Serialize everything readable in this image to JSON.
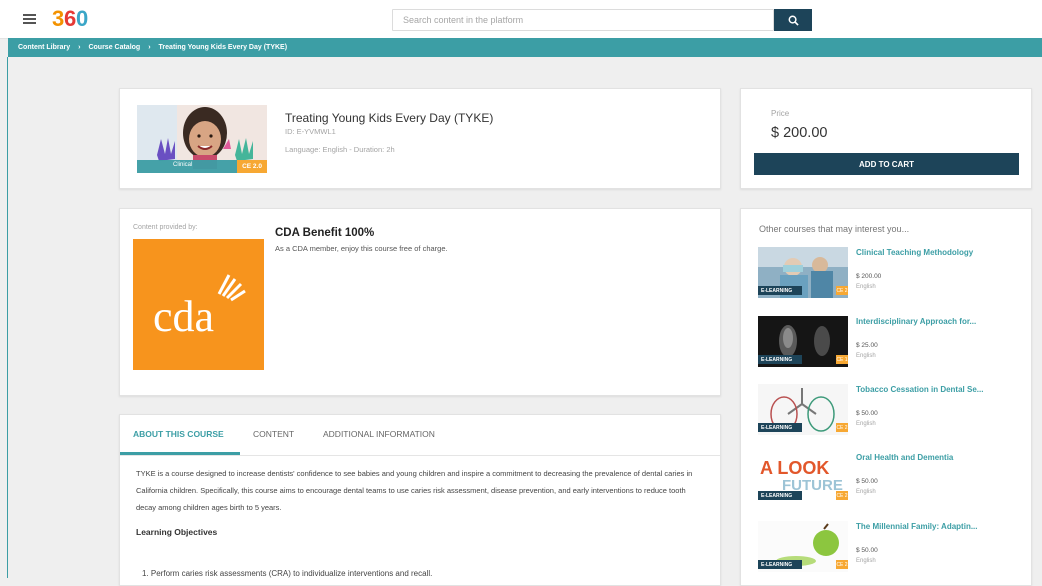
{
  "header": {
    "logo_text": "360",
    "search_placeholder": "Search content in the platform"
  },
  "breadcrumb": [
    "Content Library",
    "Course Catalog",
    "Treating Young Kids Every Day (TYKE)"
  ],
  "course": {
    "title": "Treating Young Kids Every Day (TYKE)",
    "id": "ID: E-YVMWL1",
    "meta": "Language: English - Duration: 2h",
    "thumb_badge": "Clinical",
    "thumb_ce": "CE 2.0"
  },
  "purchase": {
    "price_label": "Price",
    "price_value": "$ 200.00",
    "cart_label": "ADD TO CART"
  },
  "provider": {
    "label": "Content provided by:",
    "logo_text": "cda",
    "benefit_title": "CDA Benefit 100%",
    "benefit_text": "As a CDA member, enjoy this course free of charge."
  },
  "tabs": [
    "ABOUT THIS COURSE",
    "CONTENT",
    "ADDITIONAL INFORMATION"
  ],
  "about": {
    "text": "TYKE is a course designed to increase dentists' confidence to see babies and young children and inspire a commitment to decreasing the prevalence of dental caries in California children. Specifically, this course aims to encourage dental teams to use caries risk assessment, disease prevention, and early interventions to reduce tooth decay among children ages birth to 5 years.",
    "objectives_title": "Learning Objectives",
    "objective_1": "1. Perform caries risk assessments (CRA) to individualize interventions and recall."
  },
  "recommendations": {
    "title": "Other courses that may interest you...",
    "badge_label": "E-LEARNING",
    "items": [
      {
        "title": "Clinical Teaching Methodology",
        "price": "$ 200.00",
        "lang": "English",
        "ce": "CE 2"
      },
      {
        "title": "Interdisciplinary Approach for...",
        "price": "$ 25.00",
        "lang": "English",
        "ce": "CE 1"
      },
      {
        "title": "Tobacco Cessation in Dental Se...",
        "price": "$ 50.00",
        "lang": "English",
        "ce": "CE 2"
      },
      {
        "title": "Oral Health and Dementia",
        "price": "$ 50.00",
        "lang": "English",
        "ce": "CE 2"
      },
      {
        "title": "The Millennial Family: Adaptin...",
        "price": "$ 50.00",
        "lang": "English",
        "ce": "CE 2"
      }
    ]
  },
  "colors": {
    "teal": "#3c9ea5",
    "navy": "#1d4459",
    "orange": "#f7941d"
  }
}
